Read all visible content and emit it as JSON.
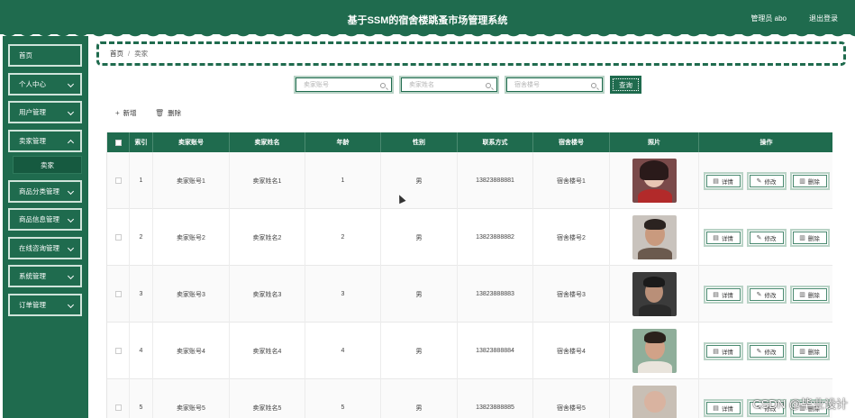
{
  "header": {
    "title": "基于SSM的宿舍楼跳蚤市场管理系统",
    "user_label": "管理员 abo",
    "logout_label": "退出登录"
  },
  "sidebar": {
    "items": [
      {
        "label": "首页",
        "has_chevron": false
      },
      {
        "label": "个人中心",
        "has_chevron": true
      },
      {
        "label": "用户管理",
        "has_chevron": true
      },
      {
        "label": "卖家管理",
        "has_chevron": true
      },
      {
        "label": "商品分类管理",
        "has_chevron": true
      },
      {
        "label": "商品信息管理",
        "has_chevron": true
      },
      {
        "label": "在线咨询管理",
        "has_chevron": true
      },
      {
        "label": "系统管理",
        "has_chevron": true
      },
      {
        "label": "订单管理",
        "has_chevron": true
      }
    ],
    "submenu_active": "卖家"
  },
  "breadcrumb": {
    "home": "首页",
    "separator": "/",
    "current": "卖家"
  },
  "search": {
    "account_placeholder": "卖家账号",
    "name_placeholder": "卖家姓名",
    "dorm_placeholder": "宿舍楼号",
    "query_label": "查询"
  },
  "toolbar": {
    "add_label": "新增",
    "delete_label": "删除"
  },
  "table": {
    "columns": [
      "索引",
      "卖家账号",
      "卖家姓名",
      "年龄",
      "性别",
      "联系方式",
      "宿舍楼号",
      "照片",
      "操作"
    ],
    "rows": [
      {
        "index": "1",
        "account": "卖家账号1",
        "name": "卖家姓名1",
        "age": "1",
        "gender": "男",
        "phone": "13823888881",
        "dorm": "宿舍楼号1"
      },
      {
        "index": "2",
        "account": "卖家账号2",
        "name": "卖家姓名2",
        "age": "2",
        "gender": "男",
        "phone": "13823888882",
        "dorm": "宿舍楼号2"
      },
      {
        "index": "3",
        "account": "卖家账号3",
        "name": "卖家姓名3",
        "age": "3",
        "gender": "男",
        "phone": "13823888883",
        "dorm": "宿舍楼号3"
      },
      {
        "index": "4",
        "account": "卖家账号4",
        "name": "卖家姓名4",
        "age": "4",
        "gender": "男",
        "phone": "13823888884",
        "dorm": "宿舍楼号4"
      },
      {
        "index": "5",
        "account": "卖家账号5",
        "name": "卖家姓名5",
        "age": "5",
        "gender": "男",
        "phone": "13823888885",
        "dorm": "宿舍楼号5"
      }
    ],
    "actions": {
      "detail": "详情",
      "edit": "修改",
      "delete": "删除"
    }
  },
  "watermark": "CSDN @毕业设计",
  "colors": {
    "primary": "#1f6b4e",
    "accent_light": "#b9d3c6"
  }
}
